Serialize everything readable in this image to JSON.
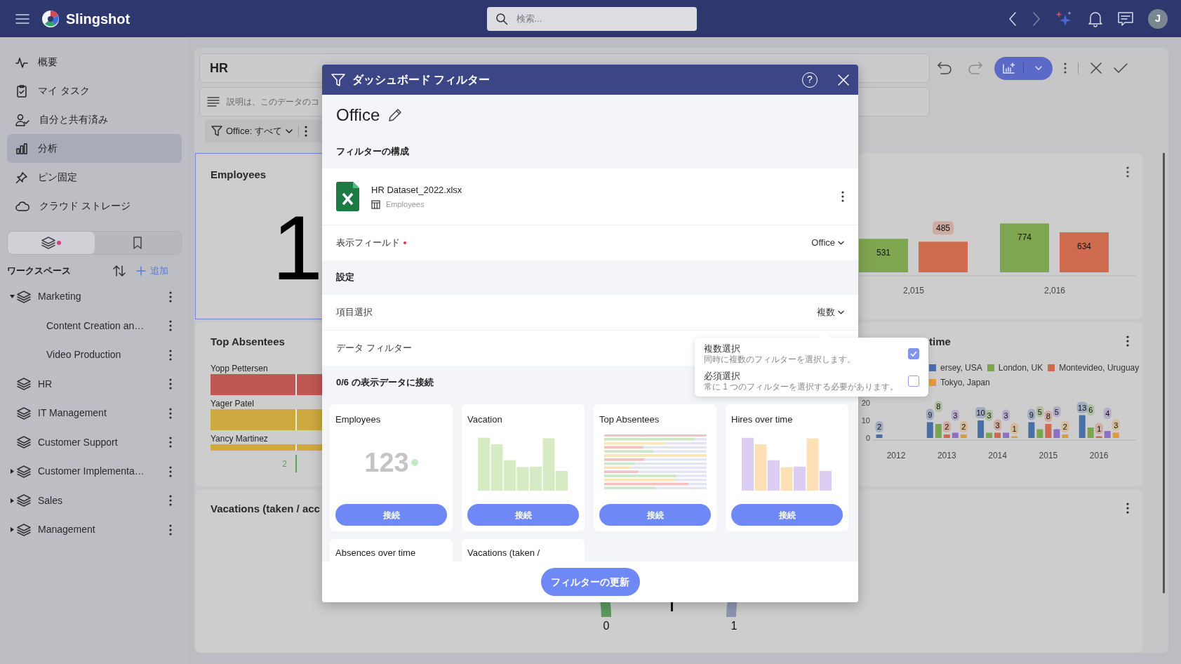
{
  "topbar": {
    "brand": "Slingshot",
    "search": {
      "placeholder": "検索..."
    },
    "back": {
      "disabled": false
    },
    "forward": {
      "disabled": true
    },
    "avatar": "J"
  },
  "sidebar": {
    "items": [
      {
        "label": "概要",
        "selected": false
      },
      {
        "label": "マイ タスク",
        "selected": false
      },
      {
        "label": "自分と共有済み",
        "selected": false
      },
      {
        "label": "分析",
        "selected": true
      },
      {
        "label": "ピン固定",
        "selected": false
      },
      {
        "label": "クラウド ストレージ",
        "selected": false
      }
    ],
    "view_tabs": [
      {
        "selected": true,
        "dot": true
      },
      {
        "selected": false,
        "dot": false
      }
    ],
    "workspaces": {
      "title": "ワークスペース",
      "add": "追加",
      "items": [
        {
          "label": "Marketing",
          "expanded": true,
          "children": [
            {
              "label": "Content Creation an…"
            },
            {
              "label": "Video Production"
            }
          ]
        },
        {
          "label": "HR"
        },
        {
          "label": "IT Management"
        },
        {
          "label": "Customer Support"
        },
        {
          "label": "Customer Implementa…",
          "expanded": false
        },
        {
          "label": "Sales",
          "expanded": false
        },
        {
          "label": "Management",
          "expanded": false
        }
      ]
    }
  },
  "dashboard": {
    "title": "HR",
    "description": {
      "placeholder": "説明は、このデータのコ"
    },
    "filter": "Office: すべて",
    "undo": {
      "disabled": false
    },
    "redo": {
      "disabled": true
    },
    "kpi_tile": {
      "title": "Employees",
      "value": "1",
      "selected": true
    },
    "bar_tile": {
      "chart_data": {
        "type": "bar",
        "categories": [
          "2,015",
          "2,016"
        ],
        "series": [
          {
            "color": "#7ea550",
            "values": [
              531,
              774
            ]
          },
          {
            "color": "#cf6c4f",
            "values": [
              485,
              634
            ]
          }
        ],
        "data_labels": true
      }
    },
    "absentees_tile": {
      "title": "Top Absentees",
      "rows": [
        {
          "name": "Yopp Pettersen",
          "color": "#bf5752"
        },
        {
          "name": "Yager Patel",
          "color": "#cda93f"
        },
        {
          "name": "Yancy Martinez",
          "color": "#cda93f"
        }
      ],
      "axis_label": "2"
    },
    "hires_tile": {
      "title": "time",
      "chart_data": {
        "type": "bar",
        "categories": [
          "2012",
          "2013",
          "2014",
          "2015",
          "2016"
        ],
        "series": [
          {
            "name": "ersey, USA",
            "color": "#4a6ea6",
            "values": [
              2,
              9,
              10,
              9,
              13
            ]
          },
          {
            "name": "London, UK",
            "color": "#7ba44f",
            "values": [
              null,
              8,
              3,
              5,
              6
            ]
          },
          {
            "name": "Montevideo, Uruguay",
            "color": "#d0694f",
            "values": [
              null,
              2,
              3,
              8,
              1
            ]
          },
          {
            "color": "#8d6fc4",
            "values": [
              null,
              3,
              3,
              5,
              4
            ]
          },
          {
            "name": "Tokyo, Japan",
            "color": "#e09a3c",
            "values": [
              null,
              2,
              1,
              2,
              3
            ]
          }
        ],
        "ylim": [
          0,
          20
        ],
        "yticks": [
          0,
          10,
          20
        ],
        "data_labels": true
      }
    },
    "vacations_tile": {
      "title": "Vacations (taken / acc",
      "gauge": {
        "min": "0",
        "max": "1"
      }
    }
  },
  "filter_dialog": {
    "title": "ダッシュボード フィルター",
    "help": "?",
    "name": "Office",
    "config_heading": "フィルターの構成",
    "data_source": {
      "file": "HR Dataset_2022.xlsx",
      "table": "Employees"
    },
    "display_field": {
      "label": "表示フィールド",
      "required": true,
      "value": "Office"
    },
    "settings_heading": "設定",
    "selection": {
      "label": "項目選択",
      "value": "複数",
      "open": true
    },
    "data_filter": {
      "label": "データ フィルター"
    },
    "connect_heading": "0/6 の表示データに接続",
    "visualizations": [
      {
        "title": "Employees",
        "kind": "number",
        "preview_text": "123",
        "button": "接続"
      },
      {
        "title": "Vacation",
        "kind": "bars",
        "button": "接続"
      },
      {
        "title": "Top Absentees",
        "kind": "hbars",
        "button": "接続"
      },
      {
        "title": "Hires over time",
        "kind": "bars_alt",
        "button": "接続"
      },
      {
        "title": "Absences over time"
      },
      {
        "title": "Vacations (taken /"
      }
    ],
    "update_button": "フィルターの更新"
  },
  "selection_menu": {
    "options": [
      {
        "title": "複数選択",
        "description": "同時に複数のフィルターを選択します。",
        "checked": true
      },
      {
        "title": "必須選択",
        "description": "常に 1 つのフィルターを選択する必要があります。",
        "checked": false
      }
    ]
  }
}
